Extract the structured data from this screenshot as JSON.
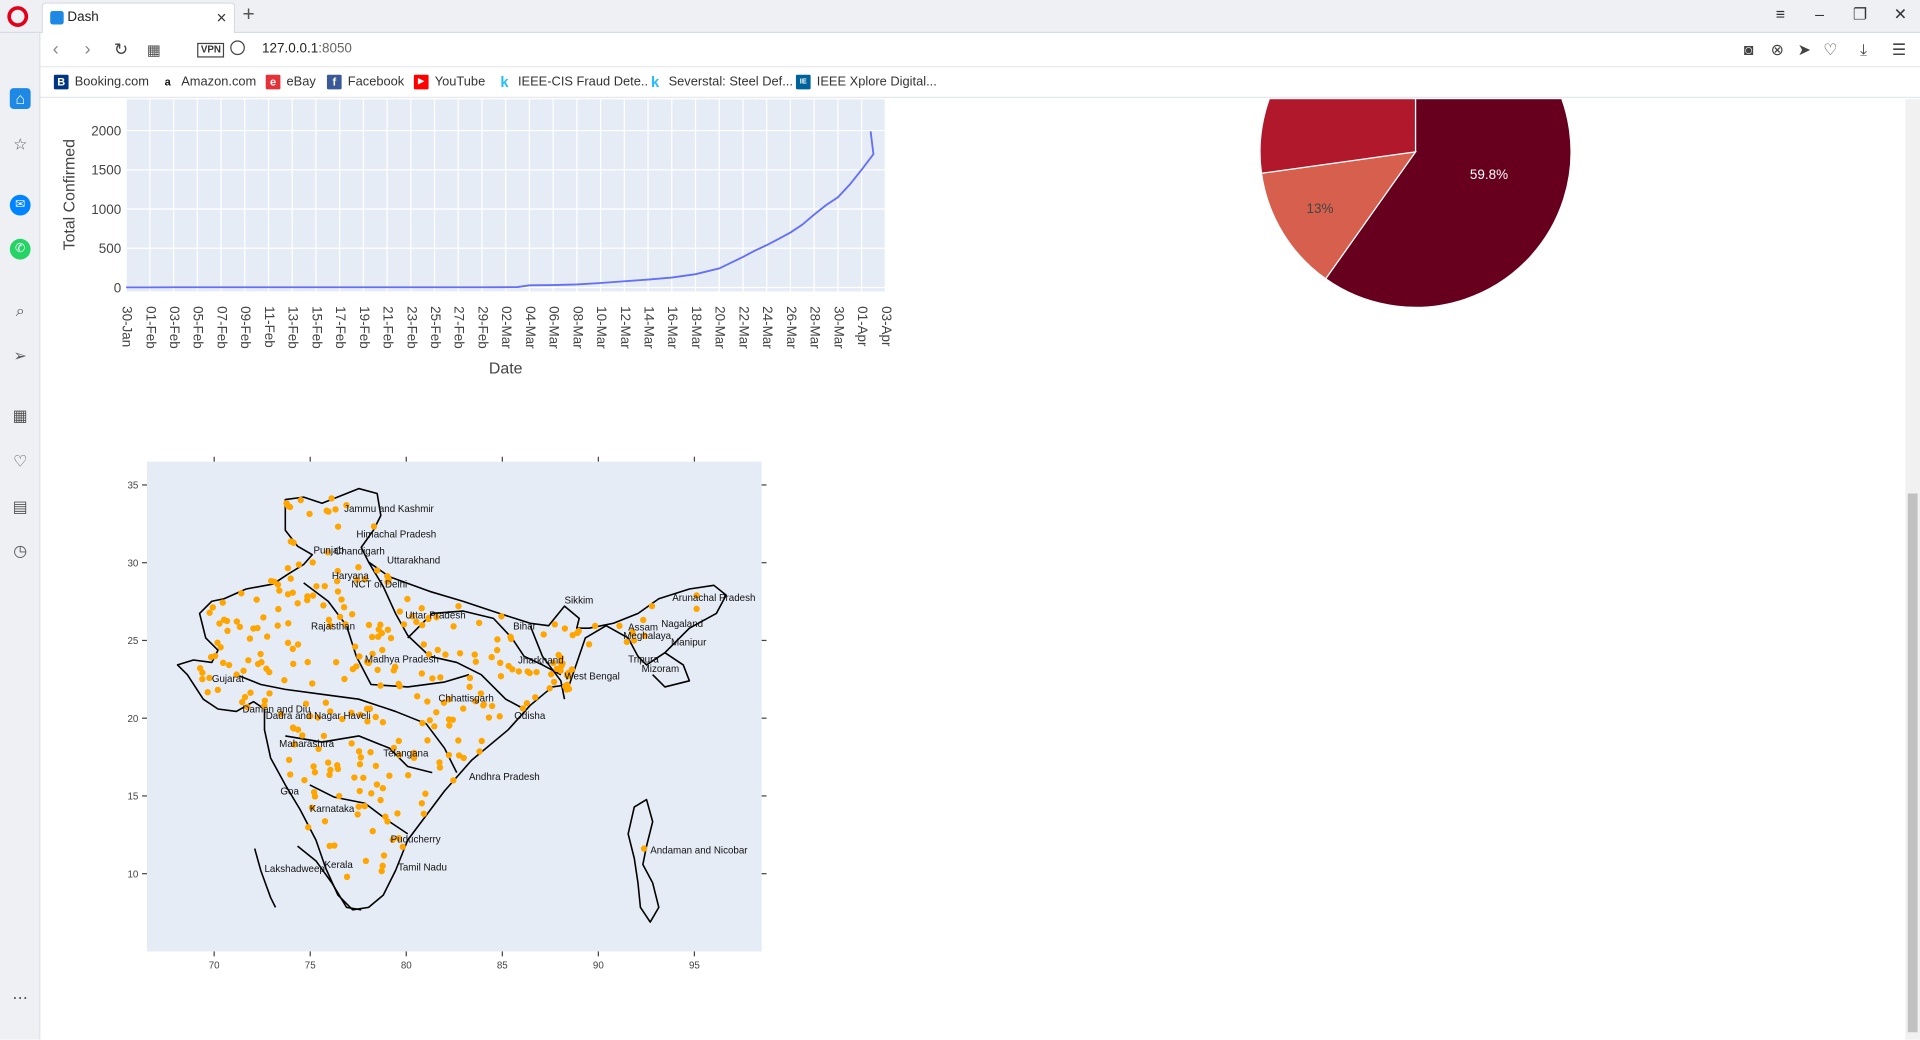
{
  "browser": {
    "tab_title": "Dash",
    "url_host": "127.0.0.1",
    "url_port": ":8050",
    "vpn_label": "VPN",
    "bookmarks": [
      {
        "label": "Booking.com",
        "icon": "B",
        "color": "#003580"
      },
      {
        "label": "Amazon.com",
        "icon": "a",
        "color": "#111111"
      },
      {
        "label": "eBay",
        "icon": "e",
        "color": "#e53238"
      },
      {
        "label": "Facebook",
        "icon": "f",
        "color": "#3b5998"
      },
      {
        "label": "YouTube",
        "icon": "▶",
        "color": "#ff0000"
      },
      {
        "label": "IEEE-CIS Fraud Dete...",
        "icon": "k",
        "color": "#20beff"
      },
      {
        "label": "Severstal: Steel Def...",
        "icon": "k",
        "color": "#20beff"
      },
      {
        "label": "IEEE Xplore Digital...",
        "icon": "IE",
        "color": "#00629b"
      }
    ]
  },
  "line_chart": {
    "ylabel": "Total Confirmed",
    "xlabel": "Date",
    "line_color": "#636efa",
    "ytick_labels": [
      "0",
      "500",
      "1000",
      "1500",
      "2000"
    ],
    "xtick_labels": [
      "30-Jan",
      "01-Feb",
      "03-Feb",
      "05-Feb",
      "07-Feb",
      "09-Feb",
      "11-Feb",
      "13-Feb",
      "15-Feb",
      "17-Feb",
      "19-Feb",
      "21-Feb",
      "23-Feb",
      "25-Feb",
      "27-Feb",
      "29-Feb",
      "02-Mar",
      "04-Mar",
      "06-Mar",
      "08-Mar",
      "10-Mar",
      "12-Mar",
      "14-Mar",
      "16-Mar",
      "18-Mar",
      "20-Mar",
      "22-Mar",
      "24-Mar",
      "26-Mar",
      "28-Mar",
      "30-Mar",
      "01-Apr",
      "03-Apr"
    ]
  },
  "pie_chart": {
    "slices": [
      {
        "label": "59.8%",
        "color": "#67001f"
      },
      {
        "label": "13%",
        "color": "#d6604d"
      },
      {
        "label": "",
        "color": "#b2182b"
      }
    ]
  },
  "map": {
    "xtick_labels": [
      "70",
      "75",
      "80",
      "85",
      "90",
      "95"
    ],
    "ytick_labels": [
      "35",
      "30",
      "25",
      "20",
      "15",
      "10"
    ],
    "marker_color": "#ffa500",
    "states": [
      "Jammu and Kashmir",
      "Himachal Pradesh",
      "Punjab",
      "Chandigarh",
      "Uttarakhand",
      "Haryana",
      "NCT of Delhi",
      "Uttar Pradesh",
      "Rajasthan",
      "Sikkim",
      "Arunachal Pradesh",
      "Assam",
      "Nagaland",
      "Meghalaya",
      "Manipur",
      "Bihar",
      "Tripura",
      "Mizoram",
      "Jharkhand",
      "West Bengal",
      "Madhya Pradesh",
      "Gujarat",
      "Chhattisgarh",
      "Odisha",
      "Daman and Diu",
      "Dadra and Nagar Haveli",
      "Maharashtra",
      "Telangana",
      "Andhra Pradesh",
      "Goa",
      "Karnataka",
      "Puducherry",
      "Andaman and Nicobar",
      "Lakshadweep",
      "Kerala",
      "Tamil Nadu"
    ]
  },
  "chart_data": [
    {
      "type": "line",
      "xlabel": "Date",
      "ylabel": "Total Confirmed",
      "x": [
        "30-Jan",
        "01-Feb",
        "03-Feb",
        "05-Feb",
        "07-Feb",
        "09-Feb",
        "11-Feb",
        "13-Feb",
        "15-Feb",
        "17-Feb",
        "19-Feb",
        "21-Feb",
        "23-Feb",
        "25-Feb",
        "27-Feb",
        "29-Feb",
        "02-Mar",
        "03-Mar",
        "04-Mar",
        "06-Mar",
        "08-Mar",
        "10-Mar",
        "12-Mar",
        "14-Mar",
        "16-Mar",
        "18-Mar",
        "20-Mar",
        "22-Mar",
        "23-Mar",
        "24-Mar",
        "25-Mar",
        "26-Mar",
        "27-Mar",
        "28-Mar",
        "29-Mar",
        "30-Mar",
        "31-Mar",
        "01-Apr",
        "02-Apr",
        "02-Apr"
      ],
      "series": [
        {
          "values": [
            1,
            2,
            3,
            3,
            3,
            3,
            3,
            3,
            3,
            3,
            3,
            3,
            3,
            3,
            3,
            3,
            5,
            6,
            28,
            31,
            39,
            58,
            80,
            102,
            126,
            170,
            244,
            390,
            470,
            540,
            620,
            700,
            800,
            930,
            1050,
            1150,
            1310,
            1500,
            1700,
            1990
          ]
        }
      ],
      "ylim": [
        -50,
        2400
      ],
      "grid": true
    },
    {
      "type": "pie",
      "slices": [
        {
          "label": "59.8%",
          "value": 59.8
        },
        {
          "label": "13%",
          "value": 13.0
        },
        {
          "label": "",
          "value": 27.2
        }
      ]
    },
    {
      "type": "scatter",
      "xlim": [
        66.5,
        98.5
      ],
      "ylim": [
        5,
        36.5
      ],
      "x_ticks": [
        70,
        75,
        80,
        85,
        90,
        95
      ],
      "y_ticks": [
        10,
        15,
        20,
        25,
        30,
        35
      ]
    }
  ]
}
